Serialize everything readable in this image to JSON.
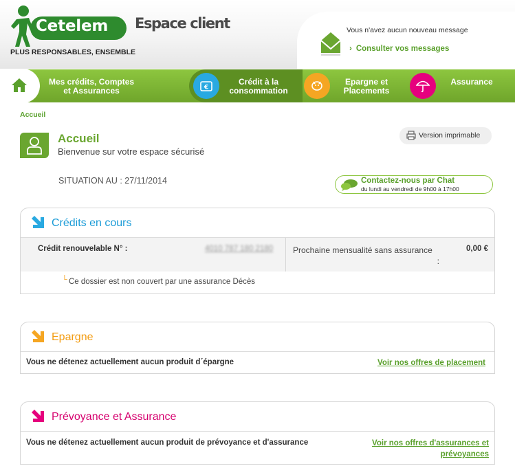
{
  "header": {
    "logo_text": "Cetelem",
    "logo_tagline": "PLUS RESPONSABLES, ENSEMBLE",
    "title": "Espace client",
    "messages": {
      "status": "Vous n'avez aucun nouveau message",
      "link": "Consulter vos messages"
    }
  },
  "nav": {
    "home_icon": "home-icon",
    "items": [
      {
        "label_l1": "Mes crédits, Comptes",
        "label_l2": "et Assurances"
      },
      {
        "label_l1": "Crédit à la",
        "label_l2": "consommation",
        "icon": "wallet-euro-icon",
        "color": "#29a9e1"
      },
      {
        "label_l1": "Epargne et",
        "label_l2": "Placements",
        "icon": "piggy-bank-icon",
        "color": "#f5a623"
      },
      {
        "label_l1": "Assurance",
        "label_l2": "",
        "icon": "umbrella-icon",
        "color": "#e6007e"
      }
    ]
  },
  "breadcrumb": "Accueil",
  "page": {
    "title": "Accueil",
    "subtitle": "Bienvenue sur votre espace sécurisé",
    "print_label": "Version imprimable",
    "situation": "SITUATION AU : 27/11/2014",
    "chat": {
      "title": "Contactez-nous par Chat",
      "hours": "du lundi au vendredi de 9h00 à 17h00"
    }
  },
  "credits": {
    "title": "Crédits en cours",
    "color": "#1a9bd7",
    "label": "Crédit renouvelable N° :",
    "number_masked": "4010 787 180 2180",
    "next_label_l1": "Prochaine mensualité sans assurance",
    "next_label_l2": ":",
    "amount": "0,00 €",
    "note": "Ce dossier est non couvert par une assurance Décès"
  },
  "epargne": {
    "title": "Epargne",
    "color": "#f39c12",
    "text": "Vous ne détenez actuellement aucun produit d´épargne",
    "link": "Voir nos offres de placement"
  },
  "prevoyance": {
    "title": "Prévoyance et Assurance",
    "color": "#d6006e",
    "text": "Vous ne détenez actuellement aucun produit de prévoyance et d'assurance",
    "link_l1": "Voir nos offres d'assurances et",
    "link_l2": "prévoyances"
  }
}
